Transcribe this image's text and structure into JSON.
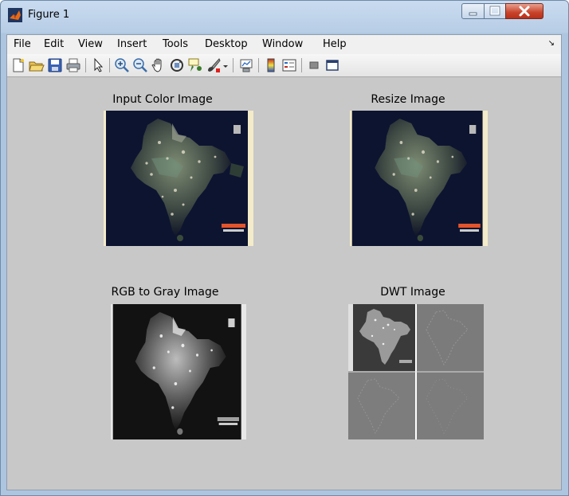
{
  "window": {
    "title": "Figure 1"
  },
  "menu": {
    "items": [
      "File",
      "Edit",
      "View",
      "Insert",
      "Tools",
      "Desktop",
      "Window",
      "Help"
    ],
    "overflow_glyph": "↘"
  },
  "toolbar": {
    "icons": [
      "new-figure-icon",
      "open-file-icon",
      "save-icon",
      "print-icon",
      "edit-plot-arrow-icon",
      "zoom-in-icon",
      "zoom-out-icon",
      "pan-hand-icon",
      "rotate-3d-icon",
      "data-cursor-icon",
      "brush-icon",
      "brush-dropdown-icon",
      "link-plot-icon",
      "colorbar-icon",
      "legend-icon",
      "hide-plot-tools-icon",
      "show-plot-tools-icon"
    ]
  },
  "axes": {
    "input_title": "Input Color Image",
    "resize_title": "Resize Image",
    "gray_title": "RGB to Gray Image",
    "dwt_title": "DWT Image"
  },
  "colors": {
    "figure_bg": "#c8c8c8",
    "frame": "#aec5e0",
    "close_button": "#c8432a"
  }
}
